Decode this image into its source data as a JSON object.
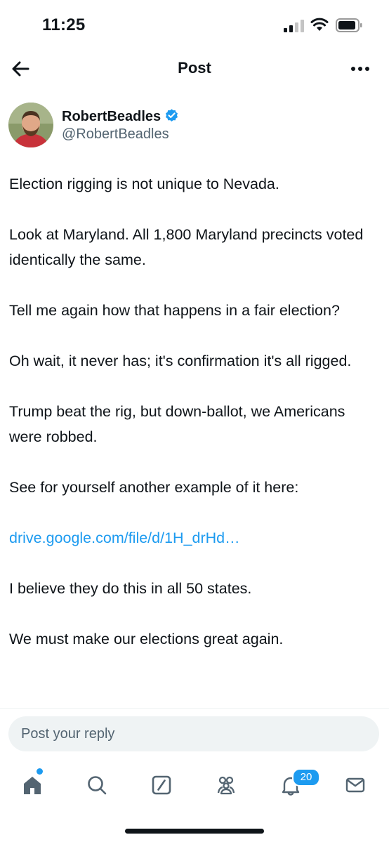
{
  "status_bar": {
    "time": "11:25"
  },
  "header": {
    "title": "Post"
  },
  "author": {
    "name": "RobertBeadles",
    "handle": "@RobertBeadles",
    "verified": true
  },
  "post": {
    "paragraphs": [
      "Election rigging is not unique to Nevada.",
      "Look at Maryland. All 1,800 Maryland precincts voted identically the same.",
      "Tell me again how that happens in a fair election?",
      "Oh wait, it never has; it's confirmation it's all rigged.",
      "Trump beat the rig, but down-ballot, we Americans were robbed.",
      "See for yourself another example of it here:"
    ],
    "link_text": "drive.google.com/file/d/1H_drHd…",
    "paragraphs_after_link": [
      "I believe they do this in all 50 states.",
      "We must make our elections great again."
    ]
  },
  "reply": {
    "placeholder": "Post your reply"
  },
  "tab_bar": {
    "tabs": [
      {
        "icon": "home-icon"
      },
      {
        "icon": "search-icon"
      },
      {
        "icon": "grok-icon"
      },
      {
        "icon": "communities-icon"
      },
      {
        "icon": "notifications-icon",
        "badge": "20"
      },
      {
        "icon": "messages-icon"
      }
    ]
  },
  "colors": {
    "accent": "#1d9bf0",
    "text": "#0f1419",
    "secondary": "#536471"
  }
}
